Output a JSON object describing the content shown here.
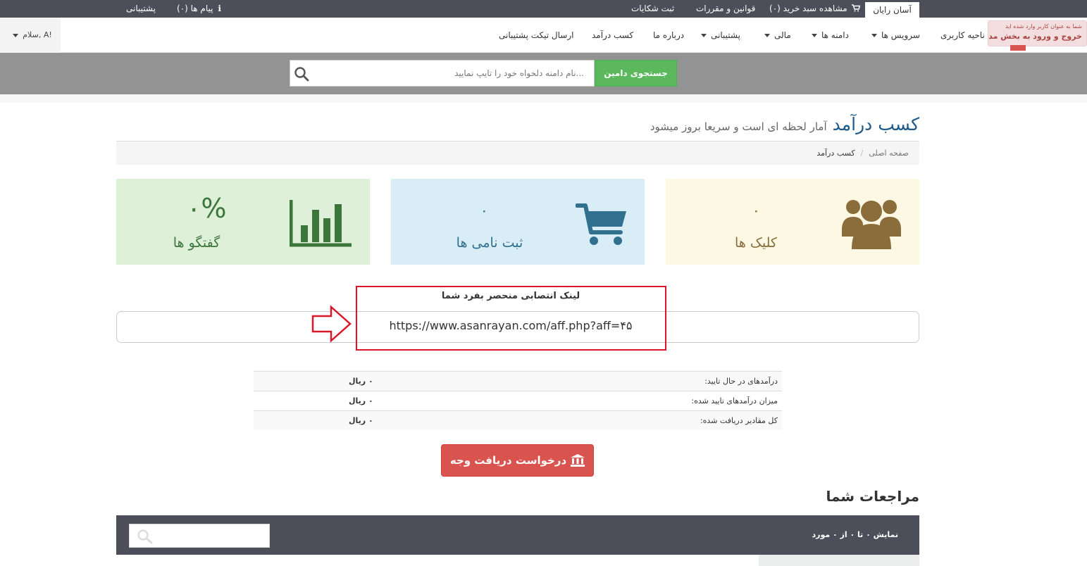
{
  "topbar": {
    "brand_tab": "آسان رایان",
    "view_cart": "مشاهده سبد خرید (۰)",
    "rules": "قوانین و مقررات",
    "complaints": "ثبت شکایات",
    "messages": "پیام ها (۰)",
    "support": "پشتیبانی"
  },
  "admin_notice": {
    "line1": "شما به عنوان کاربر وارد شده اید",
    "line2": "خروج و ورود به بخش مدیریتی"
  },
  "nav": {
    "user_area": "ناحیه کاربری",
    "services": "سرویس ها",
    "domains": "دامنه ها",
    "finance": "مالی",
    "support": "پشتیبانی",
    "about": "درباره ما",
    "earn": "کسب درآمد",
    "send_ticket": "ارسال تیکت پشتیبانی",
    "greeting": "سلام, A!"
  },
  "domain_search": {
    "placeholder": "...نام دامنه دلخواه خود را تایپ نمایید",
    "button": "جستجوی دامین"
  },
  "header": {
    "title": "کسب درآمد",
    "subtitle": "آمار لحظه ای است و سریعا بروز میشود"
  },
  "breadcrumb": {
    "home": "صفحه اصلی",
    "separator": "/",
    "current": "کسب درآمد"
  },
  "stats": {
    "clicks": {
      "value": "۰",
      "label": "کلیک ها",
      "icon": "users-icon",
      "bg": "#fcf8e3",
      "color": "#8a6d3b"
    },
    "signups": {
      "value": "۰",
      "label": "ثبت نامی ها",
      "icon": "cart-icon",
      "bg": "#d9edf7",
      "color": "#31708f"
    },
    "conversions": {
      "value": "۰%",
      "label": "گفتگو ها",
      "icon": "bar-chart-icon",
      "bg": "#dff0d8",
      "color": "#3c763d"
    }
  },
  "referral": {
    "title": "لینک انتصابی منحصر بفرد شما",
    "url": "https://www.asanrayan.com/aff.php?aff=۴۵"
  },
  "earnings": [
    {
      "label": "درآمدهای در حال تایید:",
      "value": "۰ ریال"
    },
    {
      "label": "میزان درآمدهای تایید شده:",
      "value": "۰ ریال"
    },
    {
      "label": "کل مقادیر دریافت شده:",
      "value": "۰ ریال"
    }
  ],
  "withdraw": {
    "label": "درخواست دریافت وجه"
  },
  "referrals": {
    "heading": "مراجعات شما",
    "info": "نمایش ۰ تا ۰ از ۰ مورد"
  }
}
